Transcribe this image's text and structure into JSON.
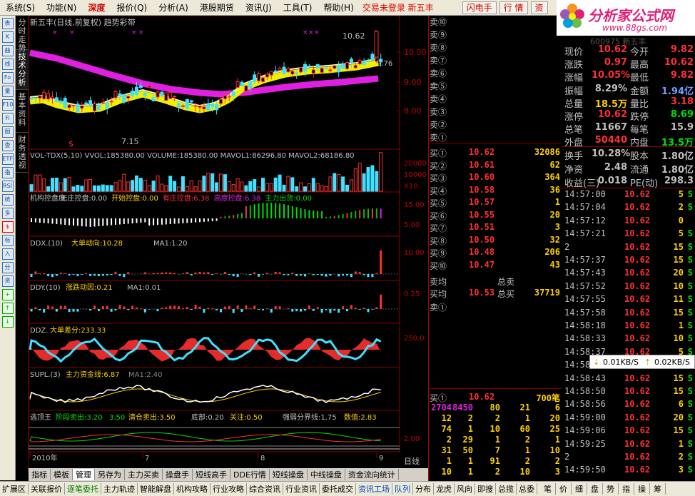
{
  "menu": {
    "items": [
      "系统",
      "功能",
      "深度",
      "报价",
      "分析",
      "港股期货",
      "资讯",
      "工具",
      "帮助"
    ],
    "shortcuts": [
      "(S)",
      "(N)",
      "",
      "(Q)",
      "(A)",
      "",
      "(J)",
      "(T)",
      "(H)"
    ],
    "status": "交易未登录 新五丰",
    "buttons": [
      "闪电手",
      "行 情",
      "资"
    ]
  },
  "logo": {
    "title": "分析家公式网",
    "url": "www.88gs.com"
  },
  "sidetabs": [
    "分时走势",
    "技术分析",
    "基本资料",
    "财务透视"
  ],
  "lefttools": [
    "表",
    "K",
    "曲",
    "线",
    "Fo",
    "量",
    "F10",
    "Fi",
    "图",
    "查",
    "ETF",
    "指",
    "RSI",
    "统",
    "多",
    "$",
    "标",
    "入",
    "分",
    "资",
    "+",
    "↑",
    "↓"
  ],
  "chart": {
    "title": "新五丰(日线,前复权) 趋势彩带",
    "high_label": "10.62",
    "low_label": "7.15",
    "last_label": "9.76",
    "price_axis": [
      "10.00",
      "9.00",
      "8.00"
    ],
    "vol_title": "VOL-TDX(5,10)  VVOL:185380.00  VOLUME:185380.00  MAVOL1:86296.80  MAVOL2:68186.80",
    "vol_axis": [
      "20000",
      "10000",
      "X10"
    ],
    "jg_title": [
      "机构控盘度",
      "无庄控盘:0.00",
      "开始控盘:0.00",
      "有庄控盘:6.38",
      "高度控盘:6.38",
      "主力出货:0.00"
    ],
    "jg_axis": [
      "15.00",
      "5.00"
    ],
    "ddx_title": [
      "DDX.(10)",
      "大单动向:10.28",
      "MA1:1.20"
    ],
    "ddx_axis": [
      "10.00"
    ],
    "ddy_title": [
      "DDY.(10)",
      "涨跌动因:0.21",
      "MA1:0.01"
    ],
    "ddy_axis": [
      "0.25"
    ],
    "ddz_title": [
      "DDZ.",
      "大单差分:233.33"
    ],
    "ddz_axis": [
      "250.0"
    ],
    "supl_title": [
      "SUPL.(3)",
      "主力资金线:6.87",
      "MA1:2.40"
    ],
    "tdw_title": [
      "逃顶王",
      "阶段卖出:3.20",
      "3.50",
      "清仓卖出:3.50",
      "底部:0.20",
      "关注:0.50",
      "强弱分界线:1.75",
      "数值:2.83"
    ],
    "tdw_axis": [
      "2.00"
    ],
    "date_axis": [
      "2010年",
      "7",
      "8",
      "9"
    ],
    "period": "日线"
  },
  "quote": {
    "sell": [
      {
        "label": "卖⑩",
        "price": "",
        "vol": ""
      },
      {
        "label": "卖⑨",
        "price": "",
        "vol": ""
      },
      {
        "label": "卖⑧",
        "price": "",
        "vol": ""
      },
      {
        "label": "卖⑦",
        "price": "",
        "vol": ""
      },
      {
        "label": "卖⑥",
        "price": "",
        "vol": ""
      },
      {
        "label": "卖⑤",
        "price": "",
        "vol": ""
      },
      {
        "label": "卖④",
        "price": "",
        "vol": ""
      },
      {
        "label": "卖③",
        "price": "",
        "vol": ""
      },
      {
        "label": "卖②",
        "price": "",
        "vol": ""
      },
      {
        "label": "卖①",
        "price": "",
        "vol": ""
      }
    ],
    "buy": [
      {
        "label": "买①",
        "price": "10.62",
        "vol": "32086"
      },
      {
        "label": "买②",
        "price": "10.61",
        "vol": "62"
      },
      {
        "label": "买③",
        "price": "10.60",
        "vol": "364"
      },
      {
        "label": "买④",
        "price": "10.58",
        "vol": "36"
      },
      {
        "label": "买⑤",
        "price": "10.57",
        "vol": "1"
      },
      {
        "label": "买⑥",
        "price": "10.55",
        "vol": "20"
      },
      {
        "label": "买⑦",
        "price": "10.51",
        "vol": "3"
      },
      {
        "label": "买⑧",
        "price": "10.50",
        "vol": "32"
      },
      {
        "label": "买⑨",
        "price": "10.48",
        "vol": "206"
      },
      {
        "label": "买⑩",
        "price": "10.47",
        "vol": "43"
      }
    ],
    "avg": [
      {
        "label": "卖均",
        "price": "",
        "label2": "总卖",
        "vol": ""
      },
      {
        "label": "买均",
        "price": "10.53",
        "label2": "总买",
        "vol": "37719"
      }
    ],
    "queue_head": {
      "label": "卖①"
    },
    "queue_buy": {
      "label": "买①",
      "price": "10.62",
      "vol": "700笔"
    }
  },
  "queue": [
    [
      "2704",
      "8450",
      "80",
      "21",
      "6"
    ],
    [
      "12",
      "2",
      "2",
      "1",
      "20"
    ],
    [
      "74",
      "1",
      "10",
      "60",
      "25"
    ],
    [
      "2",
      "29",
      "1",
      "2",
      "1"
    ],
    [
      "31",
      "50",
      "7",
      "1",
      "10"
    ],
    [
      "1",
      "1",
      "91",
      "2",
      "2"
    ],
    [
      "10",
      "1",
      "2",
      "10",
      "3"
    ]
  ],
  "stats": {
    "code": "600975 新五丰",
    "rows": [
      {
        "l": "现价",
        "v": "10.62",
        "vc": "#ff3030",
        "l2": "今开",
        "v2": "9.82",
        "v2c": "#ff3030"
      },
      {
        "l": "涨跌",
        "v": "0.97",
        "vc": "#ff3030",
        "l2": "最高",
        "v2": "10.62",
        "v2c": "#ff3030"
      },
      {
        "l": "涨幅",
        "v": "10.05%",
        "vc": "#ff3030",
        "l2": "最低",
        "v2": "9.82",
        "v2c": "#ff3030"
      },
      {
        "l": "振幅",
        "v": "8.29%",
        "vc": "#c0c0c0",
        "l2": "金额",
        "v2": "1.94亿",
        "v2c": "#6fa0ff"
      },
      {
        "l": "总量",
        "v": "18.5万",
        "vc": "#ffd000",
        "l2": "量比",
        "v2": "3.18",
        "v2c": "#ff3030"
      },
      {
        "l": "涨停",
        "v": "10.62",
        "vc": "#ff3030",
        "l2": "跌停",
        "v2": "8.69",
        "v2c": "#00e000"
      },
      {
        "l": "总笔",
        "v": "11667",
        "vc": "#c0c0c0",
        "l2": "每笔",
        "v2": "15.9",
        "v2c": "#c0c0c0"
      },
      {
        "l": "外盘",
        "v": "50440",
        "vc": "#ff3030",
        "l2": "内盘",
        "v2": "13.5万",
        "v2c": "#00e000"
      },
      {
        "l": "换手",
        "v": "10.28%",
        "vc": "#c0c0c0",
        "l2": "股本",
        "v2": "1.80亿",
        "v2c": "#c0c0c0"
      },
      {
        "l": "净资",
        "v": "2.48",
        "vc": "#c0c0c0",
        "l2": "流通",
        "v2": "1.80亿",
        "v2c": "#c0c0c0"
      },
      {
        "l": "收益(三)",
        "v": "0.018",
        "vc": "#c0c0c0",
        "l2": "PE(动)",
        "v2": "298.3",
        "v2c": "#c0c0c0"
      }
    ]
  },
  "ticks": [
    {
      "t": "14:57:00",
      "p": "10.62",
      "v": "5",
      "s": "S",
      "sc": "#00e000"
    },
    {
      "t": "14:57:04",
      "p": "10.62",
      "v": "2",
      "s": "S",
      "sc": "#00e000"
    },
    {
      "t": "14:57:12",
      "p": "10.62",
      "v": "0",
      "s": "",
      "sc": "#c0c0c0"
    },
    {
      "t": "14:57:21",
      "p": "10.62",
      "v": "5",
      "s": "S",
      "sc": "#00e000"
    },
    {
      "t": "2",
      "p": "10.62",
      "v": "15",
      "s": "S",
      "sc": "#00e000"
    },
    {
      "t": "14:57:37",
      "p": "10.62",
      "v": "15",
      "s": "S",
      "sc": "#00e000"
    },
    {
      "t": "14:57:43",
      "p": "10.62",
      "v": "20",
      "s": "S",
      "sc": "#00e000"
    },
    {
      "t": "14:57:52",
      "p": "10.62",
      "v": "10",
      "s": "S",
      "sc": "#00e000"
    },
    {
      "t": "14:57:55",
      "p": "10.62",
      "v": "11",
      "s": "S",
      "sc": "#00e000"
    },
    {
      "t": "14:57:58",
      "p": "10.62",
      "v": "15",
      "s": "S",
      "sc": "#00e000"
    },
    {
      "t": "14:58:18",
      "p": "10.62",
      "v": "1",
      "s": "S",
      "sc": "#00e000"
    },
    {
      "t": "14:58:33",
      "p": "10.62",
      "v": "10",
      "s": "S",
      "sc": "#00e000"
    },
    {
      "t": "14:58:37",
      "p": "10.62",
      "v": "5",
      "s": "S",
      "sc": "#00e000"
    },
    {
      "t": "14:58:40",
      "p": "10.62",
      "v": "5",
      "s": "S",
      "sc": "#00e000"
    },
    {
      "t": "14:58:43",
      "p": "10.62",
      "v": "15",
      "s": "S",
      "sc": "#00e000"
    },
    {
      "t": "14:58:50",
      "p": "10.62",
      "v": "15",
      "s": "S",
      "sc": "#00e000"
    },
    {
      "t": "14:58:56",
      "p": "10.62",
      "v": "6",
      "s": "S",
      "sc": "#00e000"
    },
    {
      "t": "14:59:00",
      "p": "10.62",
      "v": "20",
      "s": "S",
      "sc": "#00e000"
    },
    {
      "t": "14:59:06",
      "p": "10.62",
      "v": "15",
      "s": "S",
      "sc": "#00e000"
    },
    {
      "t": "14:59:25",
      "p": "10.62",
      "v": "1",
      "s": "S",
      "sc": "#00e000"
    },
    {
      "t": "2",
      "p": "10.62",
      "v": "2",
      "s": "S",
      "sc": "#00e000"
    },
    {
      "t": "14:59:50",
      "p": "10.62",
      "v": "3",
      "s": "S",
      "sc": "#00e000"
    }
  ],
  "netpopup": {
    "down": "0.01KB/S",
    "up": "0.02KB/S"
  },
  "subtabs": [
    "指标",
    "模板",
    "管理",
    "另存为",
    "主力买卖",
    "操盘手",
    "短线高手",
    "DDE行情",
    "短线操盘",
    "中线操盘",
    "资金流向统计"
  ],
  "bottomtabs": [
    "扩展区",
    "关联报价",
    "逐笔委托",
    "主力轨迹",
    "智能解盘",
    "机构攻略",
    "行业攻略",
    "综合资讯",
    "行业资讯",
    "委托成交",
    "资讯工场"
  ],
  "quotetabs": [
    "队列",
    "分布",
    "龙虎",
    "风向",
    "即搜",
    "总揽",
    "总委"
  ],
  "ticktabs": [
    "笔",
    "价",
    "细",
    "盘",
    "势",
    "指",
    "操",
    "筹"
  ]
}
